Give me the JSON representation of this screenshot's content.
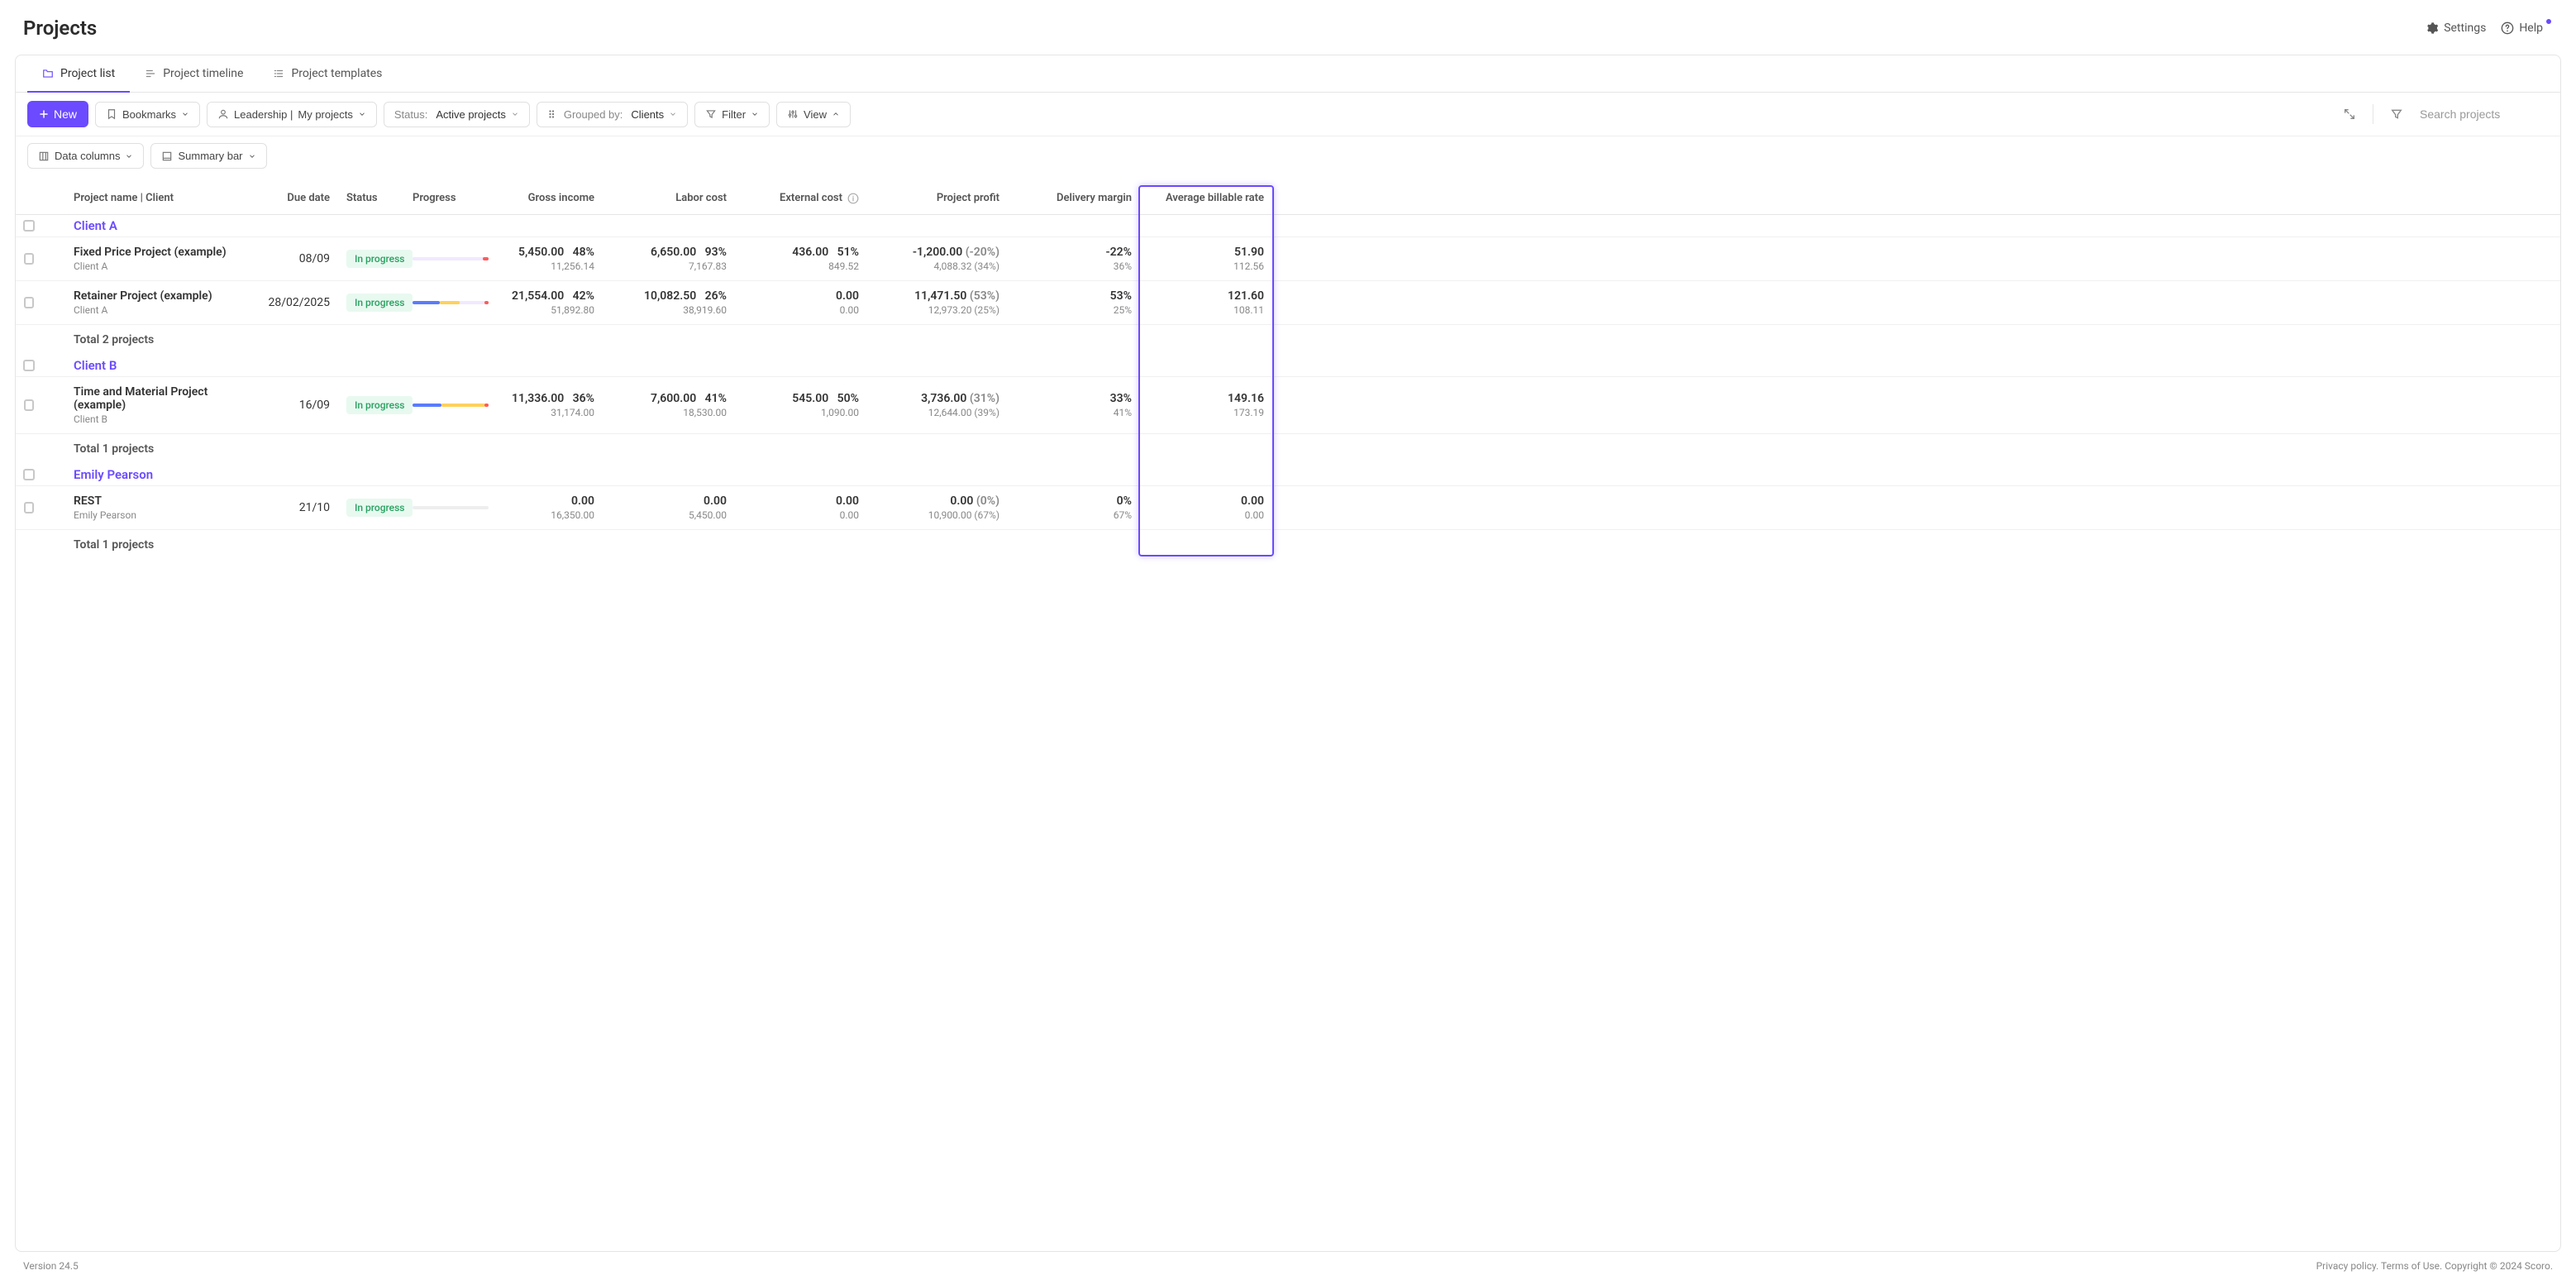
{
  "page": {
    "title": "Projects"
  },
  "header": {
    "settings": "Settings",
    "help": "Help"
  },
  "tabs": [
    {
      "label": "Project list"
    },
    {
      "label": "Project timeline"
    },
    {
      "label": "Project templates"
    }
  ],
  "toolbar": {
    "new_label": "New",
    "bookmarks_label": "Bookmarks",
    "leadership_prefix": "Leadership | ",
    "leadership_value": "My projects",
    "status_prefix": "Status:",
    "status_value": "Active projects",
    "grouped_prefix": "Grouped by:",
    "grouped_value": "Clients",
    "filter_label": "Filter",
    "view_label": "View",
    "search_placeholder": "Search projects"
  },
  "toolbar2": {
    "data_columns": "Data columns",
    "summary_bar": "Summary bar"
  },
  "columns": {
    "name": "Project name | Client",
    "due": "Due date",
    "status": "Status",
    "progress": "Progress",
    "gross": "Gross income",
    "labor": "Labor cost",
    "external": "External cost",
    "profit": "Project profit",
    "delivery": "Delivery margin",
    "avg_rate": "Average billable rate"
  },
  "groups": [
    {
      "id": "a",
      "name": "Client A",
      "rows": [
        {
          "folder_color": "y",
          "name": "Fixed Price Project (example)",
          "client": "Client A",
          "due": "08/09",
          "status": "In progress",
          "progress": {
            "segments": [],
            "end_red": true,
            "dim": false
          },
          "gross": {
            "top": "5,450.00",
            "pct": "48%",
            "bot": "11,256.14"
          },
          "labor": {
            "top": "6,650.00",
            "pct": "93%",
            "bot": "7,167.83"
          },
          "external": {
            "top": "436.00",
            "pct": "51%",
            "bot": "849.52"
          },
          "profit": {
            "top": "-1,200.00",
            "tpct": "(-20%)",
            "bot": "4,088.32",
            "bpct": "(34%)"
          },
          "delivery": {
            "top": "-22%",
            "bot": "36%"
          },
          "rate": {
            "top": "51.90",
            "bot": "112.56"
          }
        },
        {
          "folder_color": "g",
          "name": "Retainer Project (example)",
          "client": "Client A",
          "due": "28/02/2025",
          "status": "In progress",
          "progress": {
            "segments": [
              {
                "c": "blue",
                "l": 0,
                "w": 36
              },
              {
                "c": "yellow",
                "l": 36,
                "w": 26
              },
              {
                "c": "red",
                "l": 95,
                "w": 5
              }
            ],
            "dim": false
          },
          "gross": {
            "top": "21,554.00",
            "pct": "42%",
            "bot": "51,892.80"
          },
          "labor": {
            "top": "10,082.50",
            "pct": "26%",
            "bot": "38,919.60"
          },
          "external": {
            "top": "0.00",
            "pct": "",
            "bot": "0.00"
          },
          "profit": {
            "top": "11,471.50",
            "tpct": "(53%)",
            "bot": "12,973.20",
            "bpct": "(25%)"
          },
          "delivery": {
            "top": "53%",
            "bot": "25%"
          },
          "rate": {
            "top": "121.60",
            "bot": "108.11"
          }
        }
      ],
      "subtotal": "Total 2 projects"
    },
    {
      "id": "b",
      "name": "Client B",
      "rows": [
        {
          "folder_color": "g",
          "name": "Time and Material Project (example)",
          "client": "Client B",
          "due": "16/09",
          "status": "In progress",
          "progress": {
            "segments": [
              {
                "c": "blue",
                "l": 0,
                "w": 38
              },
              {
                "c": "yellow",
                "l": 38,
                "w": 58
              },
              {
                "c": "red",
                "l": 95,
                "w": 5
              }
            ],
            "dim": false
          },
          "gross": {
            "top": "11,336.00",
            "pct": "36%",
            "bot": "31,174.00"
          },
          "labor": {
            "top": "7,600.00",
            "pct": "41%",
            "bot": "18,530.00"
          },
          "external": {
            "top": "545.00",
            "pct": "50%",
            "bot": "1,090.00"
          },
          "profit": {
            "top": "3,736.00",
            "tpct": "(31%)",
            "bot": "12,644.00",
            "bpct": "(39%)"
          },
          "delivery": {
            "top": "33%",
            "bot": "41%"
          },
          "rate": {
            "top": "149.16",
            "bot": "173.19"
          }
        }
      ],
      "subtotal": "Total 1 projects"
    },
    {
      "id": "e",
      "name": "Emily Pearson",
      "rows": [
        {
          "folder_color": "gr",
          "name": "REST",
          "client": "Emily Pearson",
          "due": "21/10",
          "status": "In progress",
          "progress": {
            "segments": [],
            "dim": true
          },
          "gross": {
            "top": "0.00",
            "pct": "",
            "bot": "16,350.00"
          },
          "labor": {
            "top": "0.00",
            "pct": "",
            "bot": "5,450.00"
          },
          "external": {
            "top": "0.00",
            "pct": "",
            "bot": "0.00"
          },
          "profit": {
            "top": "0.00",
            "tpct": "(0%)",
            "bot": "10,900.00",
            "bpct": "(67%)"
          },
          "delivery": {
            "top": "0%",
            "bot": "67%"
          },
          "rate": {
            "top": "0.00",
            "bot": "0.00"
          }
        }
      ],
      "subtotal": "Total 1 projects"
    }
  ],
  "footer": {
    "version": "Version 24.5",
    "privacy": "Privacy policy",
    "terms": "Terms of Use",
    "copyright": "Copyright © 2024 Scoro."
  },
  "highlight_col_index": 11
}
